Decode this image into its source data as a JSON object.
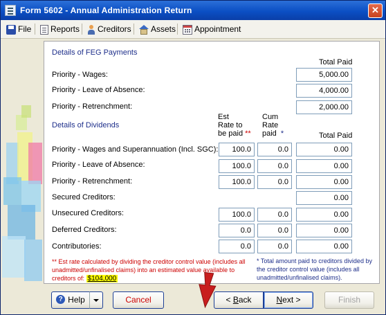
{
  "window": {
    "title": "Form 5602 - Annual Administration Return",
    "close_label": "✕"
  },
  "toolbar": {
    "file": "File",
    "reports": "Reports",
    "creditors": "Creditors",
    "assets": "Assets",
    "appointment": "Appointment"
  },
  "feg": {
    "heading": "Details of FEG Payments",
    "total_paid_header": "Total Paid",
    "rows": [
      {
        "label": "Priority - Wages:",
        "total": "5,000.00"
      },
      {
        "label": "Priority - Leave of Absence:",
        "total": "4,000.00"
      },
      {
        "label": "Priority - Retrenchment:",
        "total": "2,000.00"
      }
    ]
  },
  "dividends": {
    "heading": "Details of Dividends",
    "col_est_lines": [
      "Est",
      "Rate to",
      "be paid"
    ],
    "col_est_marker": "**",
    "col_cum_lines": [
      "Cum",
      "Rate",
      "paid"
    ],
    "col_cum_marker": "*",
    "col_total": "Total Paid",
    "rows": [
      {
        "label": "Priority - Wages and Superannuation (Incl. SGC):",
        "est": "100.0",
        "cum": "0.0",
        "total": "0.00"
      },
      {
        "label": "Priority - Leave of Absence:",
        "est": "100.0",
        "cum": "0.0",
        "total": "0.00"
      },
      {
        "label": "Priority - Retrenchment:",
        "est": "100.0",
        "cum": "0.0",
        "total": "0.00"
      },
      {
        "label": "Secured Creditors:",
        "est": null,
        "cum": null,
        "total": "0.00"
      },
      {
        "label": "Unsecured Creditors:",
        "est": "100.0",
        "cum": "0.0",
        "total": "0.00"
      },
      {
        "label": "Deferred Creditors:",
        "est": "0.0",
        "cum": "0.0",
        "total": "0.00"
      },
      {
        "label": "Contributories:",
        "est": "0.0",
        "cum": "0.0",
        "total": "0.00"
      }
    ]
  },
  "notes": {
    "est_marker": "**",
    "est_text": "Est rate calculated by dividing the creditor control value (includes all unadmitted/unfinalised claims) into an estimated value available to creditors of:",
    "est_value": "$104,000",
    "cum_marker": "*",
    "cum_text": "Total amount paid to creditors divided by the creditor control value (includes all unadmitted/unfinalised claims)."
  },
  "buttons": {
    "help": "Help",
    "cancel": "Cancel",
    "back_prefix": "< ",
    "back_key": "B",
    "back_rest": "ack",
    "next_key": "N",
    "next_rest": "ext",
    "next_suffix": " >",
    "finish": "Finish"
  },
  "colors": {
    "accent_blue": "#1d2e8a",
    "note_red": "#cc0000",
    "highlight": "#ffff00"
  }
}
